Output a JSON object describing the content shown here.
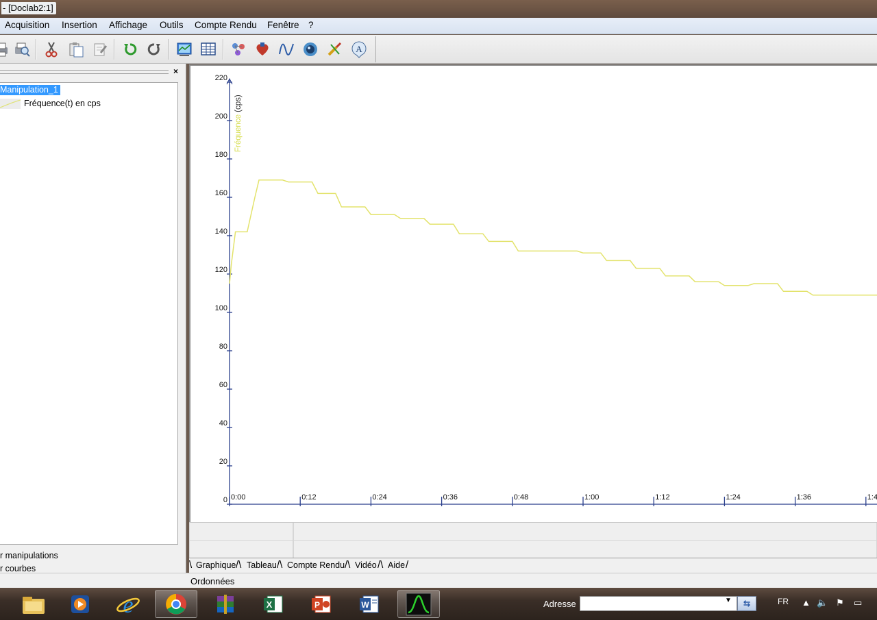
{
  "window": {
    "title": "- [Doclab2:1]"
  },
  "menu": {
    "items": [
      {
        "label": "Acquisition"
      },
      {
        "label": "Insertion"
      },
      {
        "label": "Affichage"
      },
      {
        "label": "Outils"
      },
      {
        "label": "Compte Rendu"
      },
      {
        "label": "Fenêtre"
      },
      {
        "label": "?"
      }
    ]
  },
  "toolbar": {
    "icons": [
      "print-icon",
      "print-preview-icon",
      "cut-icon",
      "paste-icon",
      "clear-icon",
      "undo-icon",
      "redo-icon",
      "graph-view-icon",
      "table-view-icon",
      "sensors-icon",
      "heart-icon",
      "curve-icon",
      "camera-icon",
      "tools-icon",
      "text-icon"
    ]
  },
  "left_panel": {
    "close_label": "×",
    "tree": {
      "root": "Manipulation_1",
      "child": "Fréquence(t) en cps",
      "child_color": "#e0e37a"
    },
    "links": [
      "r manipulations",
      "r courbes"
    ]
  },
  "chart_data": {
    "type": "line",
    "ylabel_prefix": "Fréquence",
    "ylabel_unit": "(cps)",
    "yticks": [
      "0",
      "20",
      "40",
      "60",
      "80",
      "100",
      "120",
      "140",
      "160",
      "180",
      "200",
      "220"
    ],
    "ylim": [
      0,
      220
    ],
    "xticks": [
      "0:00",
      "0:12",
      "0:24",
      "0:36",
      "0:48",
      "1:00",
      "1:12",
      "1:24",
      "1:36",
      "1:4"
    ],
    "xlim_seconds": [
      0,
      110
    ],
    "grid": false,
    "series": [
      {
        "color": "#e3e36c",
        "x": [
          0,
          0.3,
          1,
          3,
          4.3,
          5,
          9,
          10,
          14,
          15,
          18,
          19,
          23,
          24,
          28,
          29,
          33,
          34,
          38,
          39,
          43,
          44,
          48,
          49,
          59,
          60,
          63,
          64,
          68,
          69,
          73,
          74,
          78,
          79,
          83,
          84,
          88,
          89,
          93,
          94,
          98,
          99,
          108,
          110
        ],
        "y": [
          115,
          125,
          142,
          142,
          160,
          169,
          169,
          168,
          168,
          162,
          162,
          155,
          155,
          151,
          151,
          149,
          149,
          146,
          146,
          141,
          141,
          137,
          137,
          132,
          132,
          131,
          131,
          127,
          127,
          123,
          123,
          119,
          119,
          116,
          116,
          114,
          114,
          115,
          115,
          111,
          111,
          109,
          109,
          109
        ]
      }
    ]
  },
  "tabs": [
    {
      "label": "Graphique"
    },
    {
      "label": "Tableau"
    },
    {
      "label": "Compte Rendu"
    },
    {
      "label": "Vidéo"
    },
    {
      "label": "Aide"
    }
  ],
  "status": {
    "text": "Ordonnées"
  },
  "taskbar": {
    "address_label": "Adresse",
    "address_value": "",
    "language": "FR"
  }
}
